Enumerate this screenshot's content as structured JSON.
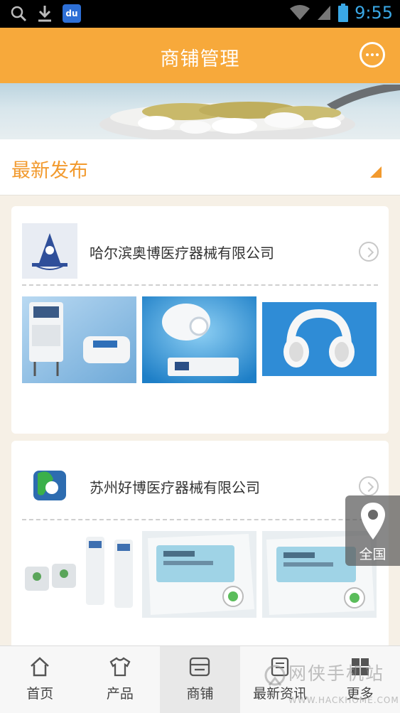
{
  "status_bar": {
    "time": "9:55",
    "baidu_label": "du",
    "icons": [
      "search-icon",
      "download-icon",
      "baidu-icon",
      "wifi-icon",
      "signal-icon",
      "battery-icon"
    ]
  },
  "header": {
    "title": "商铺管理",
    "action_icon": "chat-bubble-icon",
    "color": "#f7a93b"
  },
  "section": {
    "title": "最新发布",
    "accent": "#f29a2e"
  },
  "stores": [
    {
      "name": "哈尔滨奥博医疗器械有限公司",
      "products": [
        "treatment-device-set",
        "head-massager-device",
        "white-headphones"
      ]
    },
    {
      "name": "苏州好博医疗器械有限公司",
      "products": [
        "physiotherapy-units",
        "control-panel-device",
        "control-panel-device"
      ]
    }
  ],
  "float_button": {
    "label": "全国",
    "icon": "location-pin-icon"
  },
  "bottom_nav": {
    "items": [
      {
        "label": "首页",
        "icon": "home-icon",
        "active": false
      },
      {
        "label": "产品",
        "icon": "shirt-icon",
        "active": false
      },
      {
        "label": "商铺",
        "icon": "shop-icon",
        "active": true
      },
      {
        "label": "最新资讯",
        "icon": "news-icon",
        "active": false
      },
      {
        "label": "更多",
        "icon": "grid-icon",
        "active": false
      }
    ]
  },
  "watermark": {
    "text": "网侠手机站",
    "url_text": "WWW.HACKHOME.COM"
  }
}
